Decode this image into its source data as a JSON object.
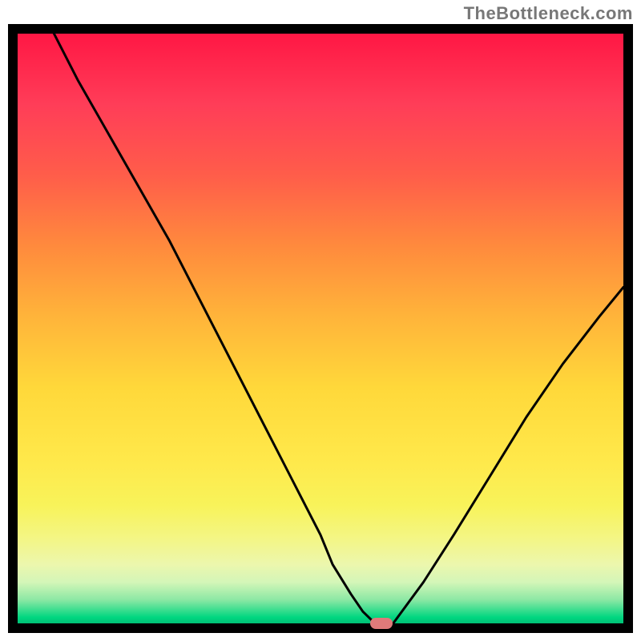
{
  "watermark": "TheBottleneck.com",
  "chart_data": {
    "type": "line",
    "title": "",
    "xlabel": "",
    "ylabel": "",
    "xlim": [
      0,
      100
    ],
    "ylim": [
      0,
      100
    ],
    "series": [
      {
        "name": "curve",
        "x": [
          6,
          10,
          15,
          20,
          25,
          30,
          35,
          40,
          45,
          50,
          52,
          55,
          57,
          59,
          61,
          62,
          67,
          72,
          78,
          84,
          90,
          96,
          100
        ],
        "y": [
          100,
          92,
          83,
          74,
          65,
          55,
          45,
          35,
          25,
          15,
          10,
          5,
          2,
          0,
          0,
          0,
          7,
          15,
          25,
          35,
          44,
          52,
          57
        ]
      }
    ],
    "marker": {
      "x": 60,
      "y": 0
    },
    "background_gradient": [
      {
        "pos": 0,
        "color": "#ff1744"
      },
      {
        "pos": 50,
        "color": "#ffd83a"
      },
      {
        "pos": 90,
        "color": "#ecf7ad"
      },
      {
        "pos": 100,
        "color": "#00c176"
      }
    ]
  }
}
